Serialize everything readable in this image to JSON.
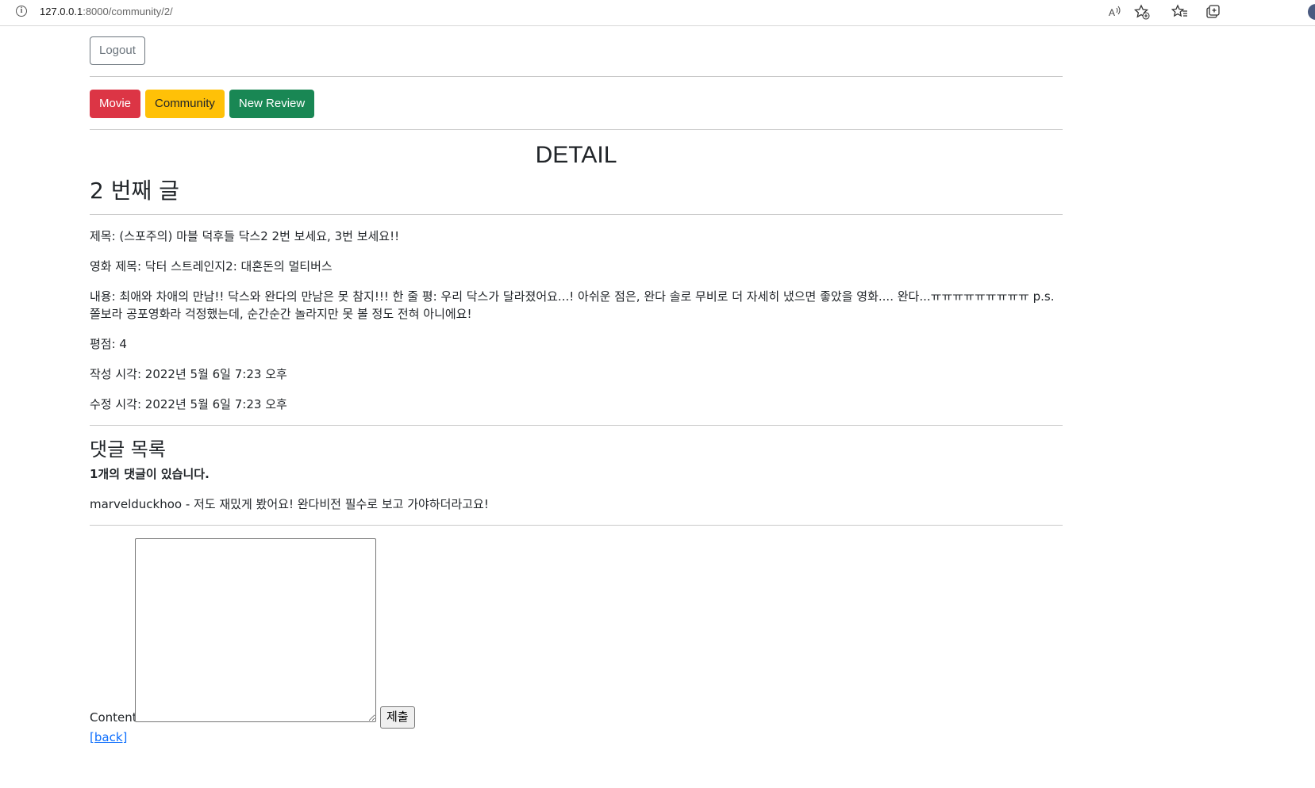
{
  "browser": {
    "url_host": "127.0.0.1",
    "url_path": ":8000/community/2/",
    "icons": [
      "info-icon",
      "read-aloud-icon",
      "add-favorite-icon",
      "favorites-icon",
      "collections-icon",
      "profile-avatar"
    ]
  },
  "header": {
    "logout_label": "Logout"
  },
  "nav": {
    "movie_label": "Movie",
    "community_label": "Community",
    "new_review_label": "New Review"
  },
  "colors": {
    "movie": "#dc3545",
    "community": "#ffc107",
    "new_review": "#198754",
    "link": "#0d6efd"
  },
  "detail": {
    "page_title": "DETAIL",
    "post_heading": "2 번째 글",
    "title_line": "제목: (스포주의) 마블 덕후들 닥스2 2번 보세요, 3번 보세요!!",
    "movie_title_line": "영화 제목: 닥터 스트레인지2: 대혼돈의 멀티버스",
    "content_line": "내용: 최애와 차애의 만남!! 닥스와 완다의 만남은 못 참지!!! 한 줄 평: 우리 닥스가 달라졌어요...! 아쉬운 점은, 완다 솔로 무비로 더 자세히 냈으면 좋았을 영화.... 완다...ㅠㅠㅠㅠㅠㅠㅠㅠㅠ p.s. 쫄보라 공포영화라 걱정했는데, 순간순간 놀라지만 못 볼 정도 전혀 아니에요!",
    "rating_line": "평점: 4",
    "created_line": "작성 시각: 2022년 5월 6일 7:23 오후",
    "updated_line": "수정 시각: 2022년 5월 6일 7:23 오후"
  },
  "comments": {
    "heading": "댓글 목록",
    "count_text": "1개의 댓글이 있습니다.",
    "items": [
      "marvelduckhoo - 저도 재밌게 봤어요! 완다비전 필수로 보고 가야하더라고요!"
    ]
  },
  "comment_form": {
    "label": "Content:",
    "value": "",
    "submit_label": "제출"
  },
  "back_link": "[back]"
}
